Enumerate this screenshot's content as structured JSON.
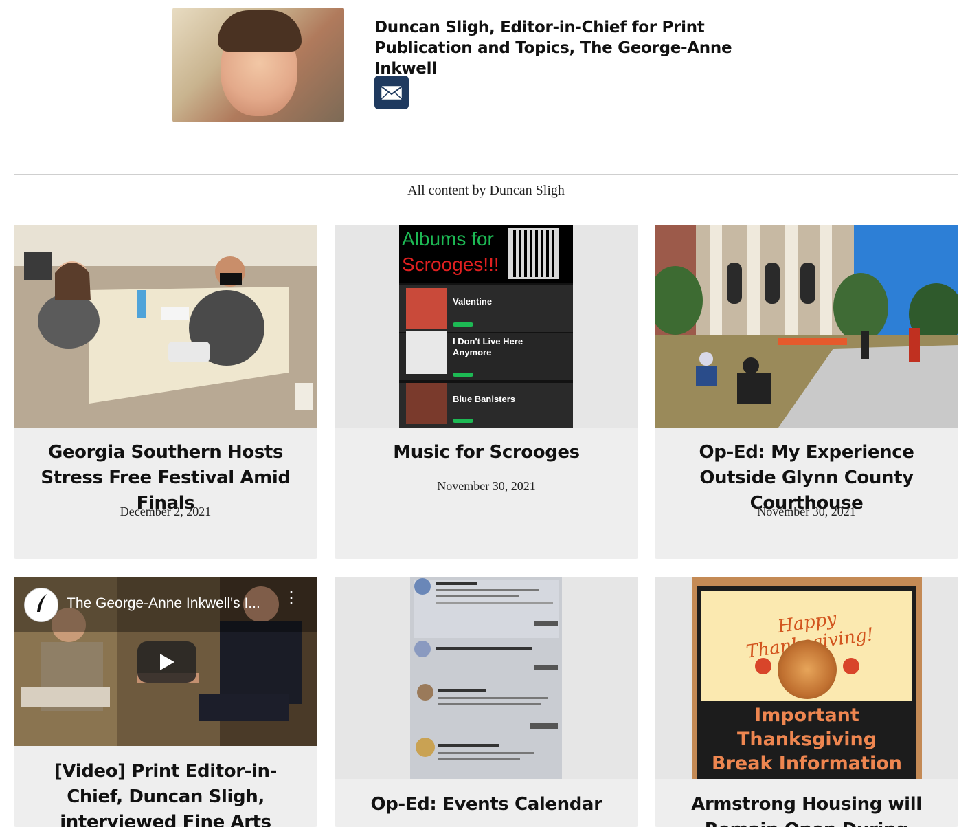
{
  "author": {
    "name": "Duncan Sligh, Editor-in-Chief for Print Publication and Topics, The George-Anne Inkwell",
    "email_icon": "envelope-icon"
  },
  "section_label": "All content by Duncan Sligh",
  "articles": [
    {
      "title": "Georgia Southern Hosts Stress Free Festival Amid Finals",
      "date": "December 2, 2021"
    },
    {
      "title": "Music for Scrooges",
      "date": "November 30, 2021",
      "thumb_text": {
        "headline_1": "Albums for",
        "headline_2": "Scrooges!!!",
        "albums": [
          "Valentine",
          "I Don't Live Here Anymore",
          "Blue Banisters"
        ]
      }
    },
    {
      "title": "Op-Ed: My Experience Outside Glynn County Courthouse",
      "date": "November 30, 2021"
    },
    {
      "title": "[Video] Print Editor-in-Chief, Duncan Sligh, interviewed Fine Arts Gallery director, Raymond",
      "date": "",
      "thumb_text": {
        "video_title": "The George-Anne Inkwell's I..."
      }
    },
    {
      "title": "Op-Ed: Events Calendar",
      "date": ""
    },
    {
      "title": "Armstrong Housing will Remain Open During Thanksgiving",
      "date": "",
      "thumb_text": {
        "greeting": "Happy Thanksgiving!",
        "line_1": "Important",
        "line_2": "Thanksgiving",
        "line_3": "Break Information"
      }
    }
  ]
}
